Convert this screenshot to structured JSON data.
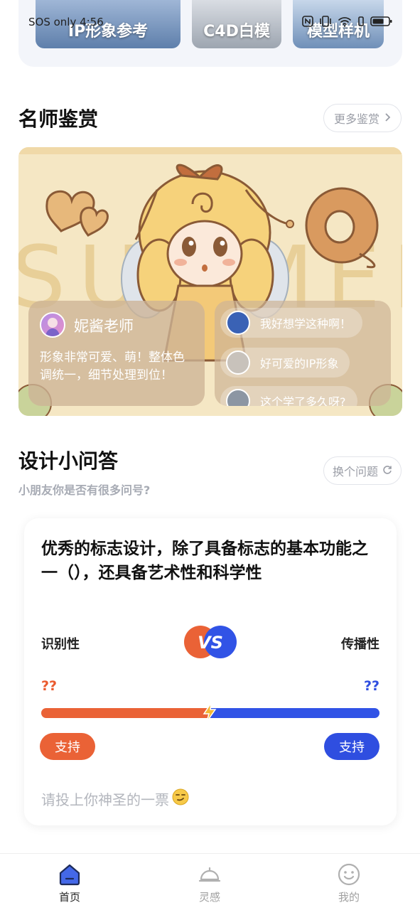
{
  "status_bar": {
    "carrier_text": "SOS only 4:56"
  },
  "categories": [
    {
      "label": "IP形象参考"
    },
    {
      "label": "C4D白模"
    },
    {
      "label": "模型样机"
    }
  ],
  "masters": {
    "title": "名师鉴赏",
    "more_label": "更多鉴赏",
    "banner_word": "SUMMER",
    "teacher": {
      "name": "妮酱老师",
      "comment": "形象非常可爱、萌！整体色调统一，细节处理到位！"
    },
    "comments": [
      {
        "text": "我好想学这种啊！"
      },
      {
        "text": "好可爱的IP形象"
      },
      {
        "text": "这个学了多久呀?"
      }
    ]
  },
  "quiz": {
    "title": "设计小问答",
    "subtitle": "小朋友你是否有很多问号?",
    "change_label": "换个问题",
    "question": "优秀的标志设计，除了具备标志的基本功能之一（），还具备艺术性和科学性",
    "vs_label": "VS",
    "option_left": "识别性",
    "option_right": "传播性",
    "count_left": "??",
    "count_right": "??",
    "left_share": 0.5,
    "support_left": "支持",
    "support_right": "支持",
    "vote_hint": "请投上你神圣的一票",
    "colors": {
      "left": "#ea6236",
      "right": "#2f4ee0"
    }
  },
  "nav": [
    {
      "label": "首页",
      "icon": "home-icon",
      "active": true
    },
    {
      "label": "灵感",
      "icon": "bell-icon",
      "active": false
    },
    {
      "label": "我的",
      "icon": "smiley-icon",
      "active": false
    }
  ]
}
